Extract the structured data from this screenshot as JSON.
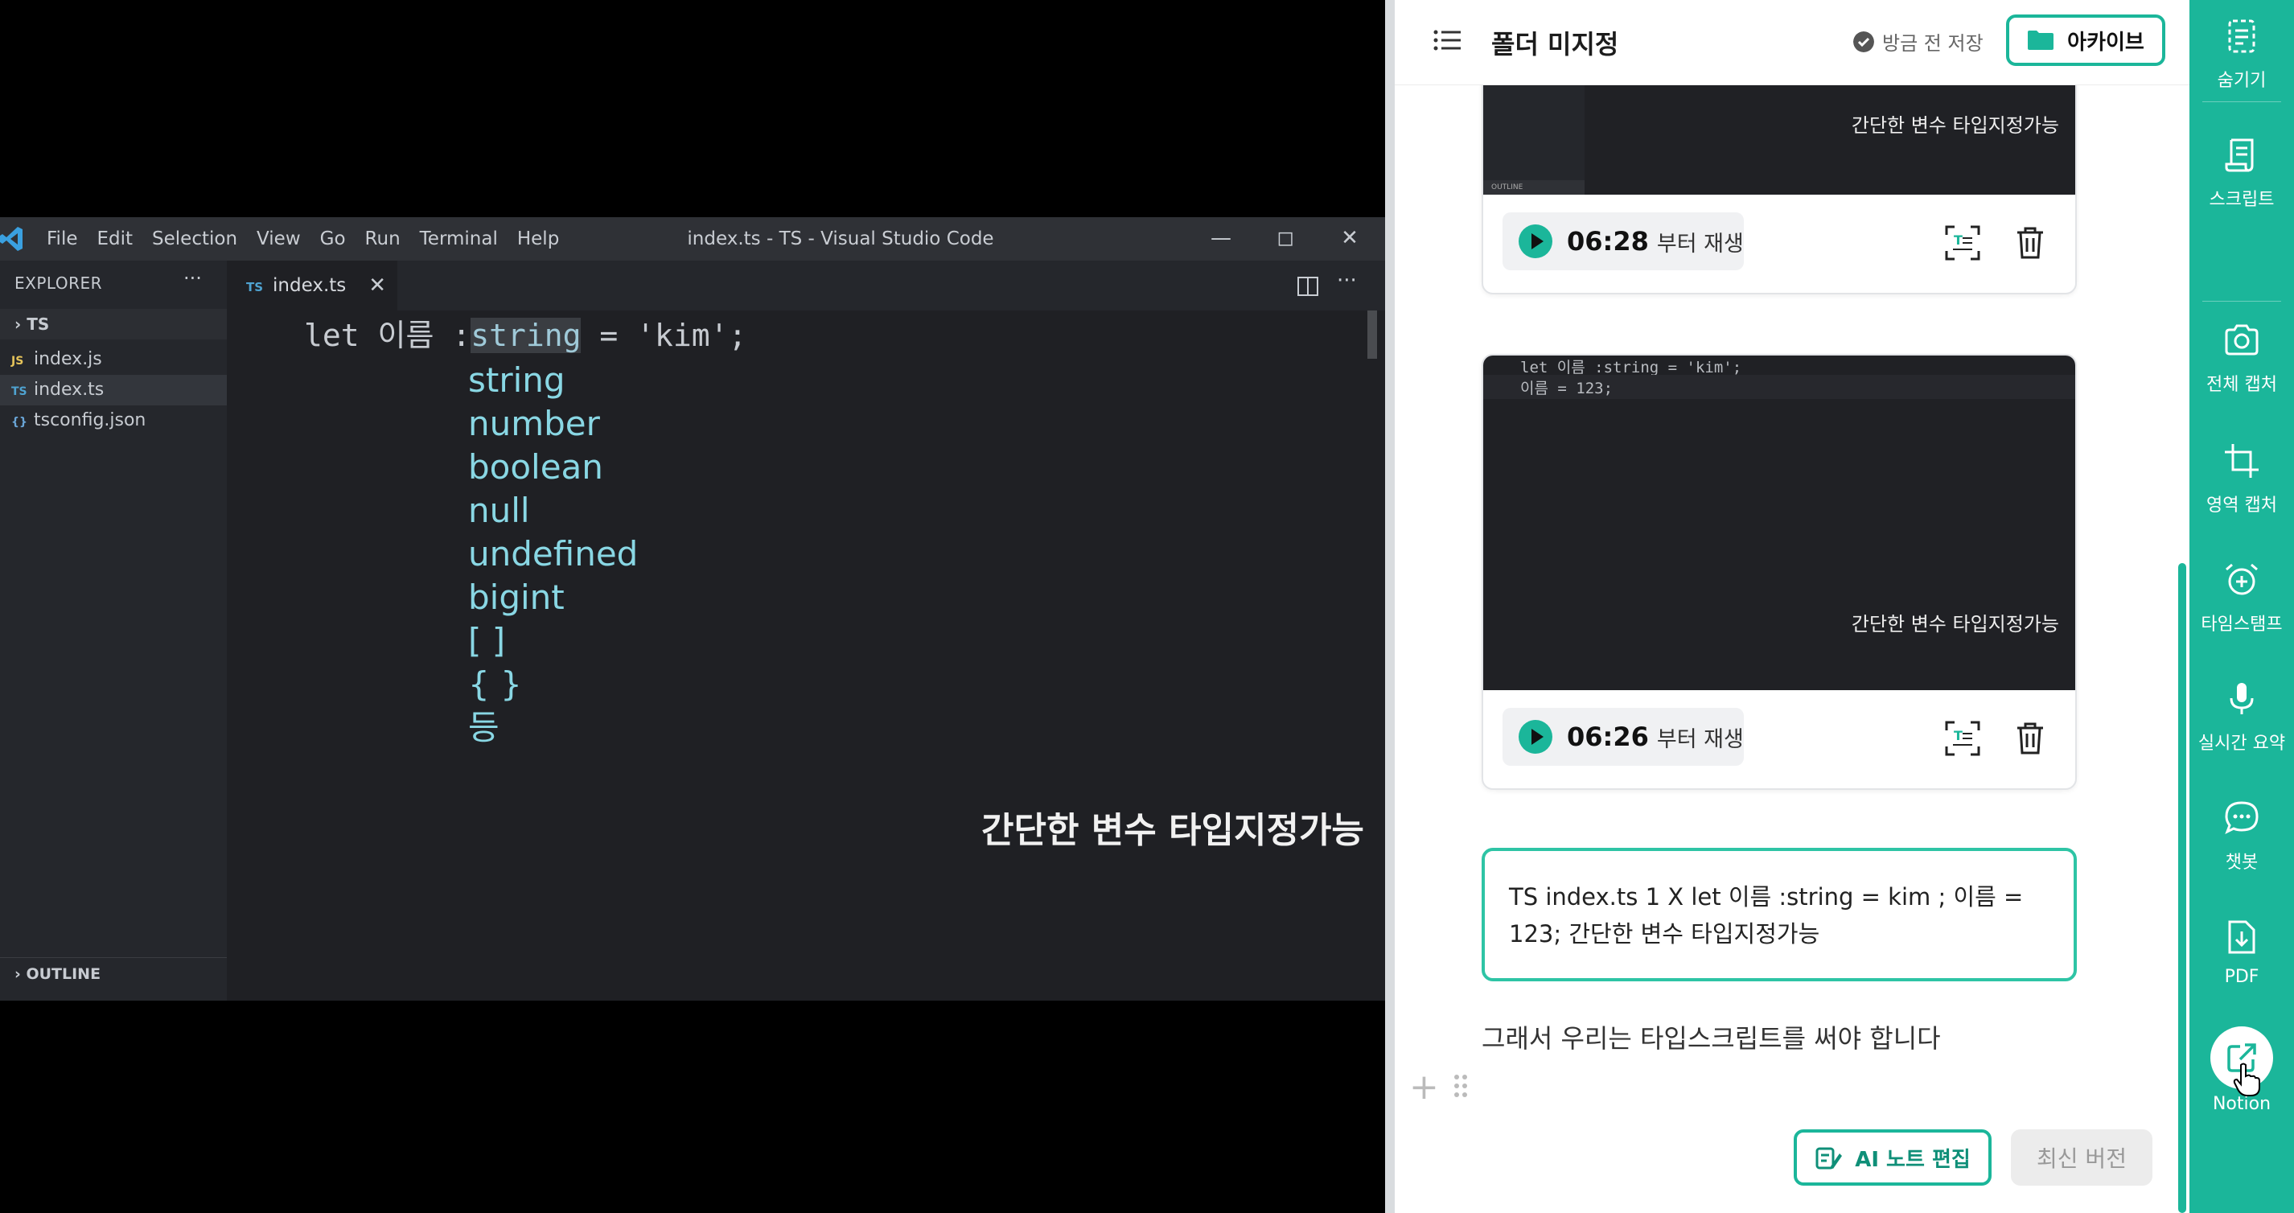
{
  "vscode": {
    "menu": [
      "File",
      "Edit",
      "Selection",
      "View",
      "Go",
      "Run",
      "Terminal",
      "Help"
    ],
    "window_title": "index.ts - TS - Visual Studio Code",
    "explorer_label": "EXPLORER",
    "explorer_more": "···",
    "folder": "TS",
    "files": [
      {
        "ext": "JS",
        "name": "index.js"
      },
      {
        "ext": "TS",
        "name": "index.ts"
      },
      {
        "ext": "{}",
        "name": "tsconfig.json"
      }
    ],
    "outline_label": "OUTLINE",
    "tab": {
      "ext": "TS",
      "name": "index.ts",
      "close": "✕"
    },
    "code_prefix": "let 이름 :",
    "code_highlight": "string",
    "code_suffix": " = 'kim';",
    "types": [
      "string",
      "number",
      "boolean",
      "null",
      "undefined",
      "bigint",
      "[ ]",
      "{ }",
      "등"
    ],
    "subtitle": "간단한 변수 타입지정가능"
  },
  "panel": {
    "folder_title": "폴더 미지정",
    "saved_label": "방금 전 저장",
    "archive_label": "아카이브",
    "cards": [
      {
        "caption": "간단한 변수 타입지정가능",
        "outline": "OUTLINE",
        "time": "06:28",
        "from": "부터 재생"
      },
      {
        "caption": "간단한 변수 타입지정가능",
        "code1": "let 이름 :string = 'kim';",
        "code2": "이름 = 123;",
        "time": "06:26",
        "from": "부터 재생"
      }
    ],
    "textbox": "TS index.ts 1 X let 이름 :string = kim ; 이름 = 123; 간단한 변수 타입지정가능",
    "body_line": "그래서 우리는 타입스크립트를 써야 합니다",
    "ai_button": "AI 노트 편집",
    "latest_button": "최신 버전"
  },
  "toolbar": {
    "items": [
      {
        "label": "숨기기",
        "icon": "hide-icon"
      },
      {
        "label": "스크립트",
        "icon": "script-icon"
      },
      {
        "label": "전체 캡처",
        "icon": "camera-icon"
      },
      {
        "label": "영역 캡처",
        "icon": "crop-icon"
      },
      {
        "label": "타임스탬프",
        "icon": "alarm-icon"
      },
      {
        "label": "실시간 요약",
        "icon": "mic-icon"
      },
      {
        "label": "챗봇",
        "icon": "chat-icon"
      },
      {
        "label": "PDF",
        "icon": "pdf-download-icon"
      },
      {
        "label": "Notion",
        "icon": "external-link-icon"
      }
    ]
  },
  "colors": {
    "accent": "#1bb69a",
    "editor_bg": "#1f2024",
    "type_text": "#89d7e4"
  }
}
